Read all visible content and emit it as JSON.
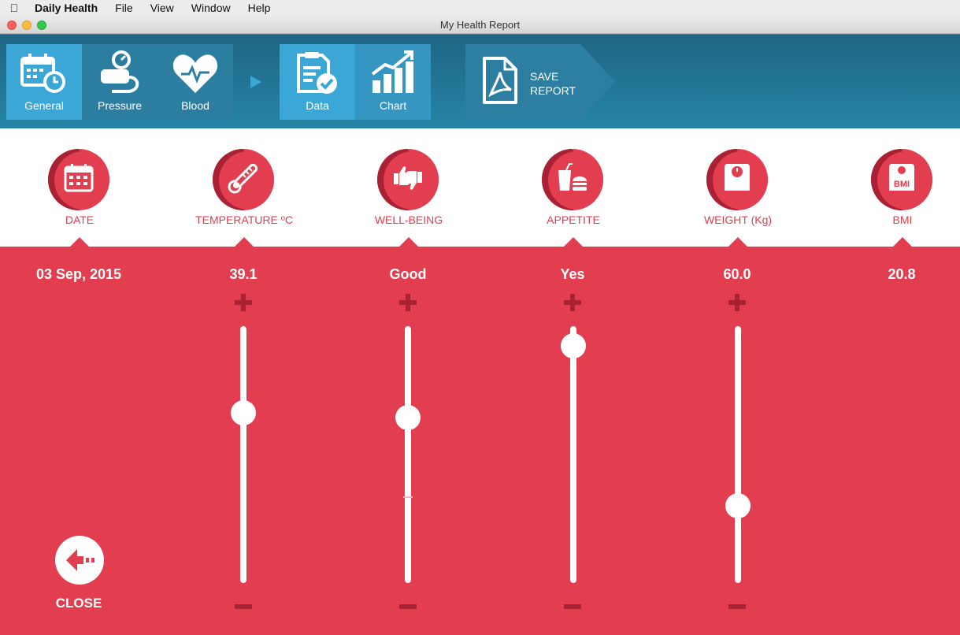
{
  "menubar": {
    "app_name": "Daily Health",
    "items": [
      "File",
      "View",
      "Window",
      "Help"
    ]
  },
  "window": {
    "title": "My Health Report"
  },
  "toolbar": {
    "buttons": [
      {
        "label": "General",
        "icon": "calendar-clock-icon",
        "active": true
      },
      {
        "label": "Pressure",
        "icon": "blood-pressure-icon",
        "active": false
      },
      {
        "label": "Blood",
        "icon": "heart-pulse-icon",
        "active": false
      },
      {
        "label": "Data",
        "icon": "document-check-icon",
        "active": true
      },
      {
        "label": "Chart",
        "icon": "growth-chart-icon",
        "active": false
      }
    ],
    "save_line1": "SAVE",
    "save_line2": "REPORT"
  },
  "columns": [
    {
      "label": "DATE",
      "icon": "calendar-icon",
      "value": "03 Sep, 2015"
    },
    {
      "label": "TEMPERATURE ºC",
      "icon": "thermometer-icon",
      "value": "39.1",
      "slider_level": 0.68
    },
    {
      "label": "WELL-BEING",
      "icon": "thumbs-icon",
      "value": "Good",
      "slider_level": 0.66
    },
    {
      "label": "APPETITE",
      "icon": "food-drink-icon",
      "value": "Yes",
      "slider_level": 0.97
    },
    {
      "label": "WEIGHT (Kg)",
      "icon": "scale-icon",
      "value": "60.0",
      "slider_level": 0.28
    },
    {
      "label": "BMI",
      "icon": "bmi-scale-icon",
      "value": "20.8"
    }
  ],
  "bmi_icon_text": "BMI",
  "close_label": "CLOSE",
  "colors": {
    "primary_red": "#e23e4f",
    "dark_red": "#a82234",
    "toolbar_blue": "#2685a5",
    "active_blue": "#3aa7d6"
  }
}
